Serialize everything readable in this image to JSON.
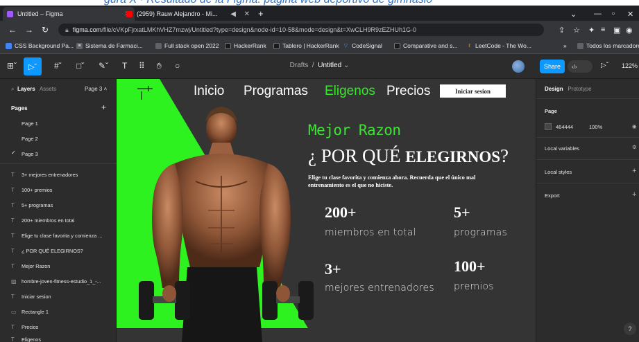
{
  "caption": "gura X · Resultado de la Figma: pagina web deportivo de gimnasio",
  "browser": {
    "tabs": [
      {
        "label": "Untitled – Figma",
        "active": true,
        "color": "#a259ff"
      },
      {
        "label": "(2959) Rauw Alejandro - Mi...",
        "active": false,
        "color": "#ff0000"
      }
    ],
    "url_host": "figma.com",
    "url_path": "/file/cVKpFjrxatLMKhVHZ7mzwj/Untitled?type=design&node-id=10-58&mode=design&t=XwCLH9R9zEZHUh1G-0",
    "bookmarks": [
      "CSS Background Pa...",
      "Sistema de Farmaci...",
      "Full stack open 2022",
      "HackerRank",
      "Tablero | HackerRank",
      "CodeSignal",
      "Comparative and s...",
      "LeetCode - The Wo..."
    ],
    "bookmarks_more": "»",
    "all_bookmarks": "Todos los marcadores"
  },
  "figma": {
    "breadcrumb_drafts": "Drafts",
    "breadcrumb_sep": "/",
    "doc_name": "Untitled",
    "share": "Share",
    "zoom": "122%",
    "left": {
      "tab_layers": "Layers",
      "tab_assets": "Assets",
      "page_selector": "Page 3",
      "pages_title": "Pages",
      "pages": [
        "Page 1",
        "Page 2",
        "Page 3"
      ],
      "layers": [
        {
          "type": "T",
          "label": "3+ mejores entrenadores"
        },
        {
          "type": "T",
          "label": "100+ premios"
        },
        {
          "type": "T",
          "label": "5+ programas"
        },
        {
          "type": "T",
          "label": "200+ miembros en total"
        },
        {
          "type": "T",
          "label": "Elige tu clase favorita y comienza ..."
        },
        {
          "type": "T",
          "label": "¿ POR QUÉ ELEGIRNOS?"
        },
        {
          "type": "T",
          "label": "Mejor Razon"
        },
        {
          "type": "img",
          "label": "hombre-joven-fitness-estudio_1_-..."
        },
        {
          "type": "T",
          "label": "Iniciar sesion"
        },
        {
          "type": "rect",
          "label": "Rectangle 1"
        },
        {
          "type": "T",
          "label": "Precios"
        },
        {
          "type": "T",
          "label": "Eligenos"
        }
      ]
    },
    "right": {
      "tab_design": "Design",
      "tab_prototype": "Prototype",
      "page_title": "Page",
      "page_color": "464444",
      "page_opacity": "100%",
      "local_variables": "Local variables",
      "local_styles": "Local styles",
      "export": "Export",
      "help": "?"
    }
  },
  "site": {
    "nav": [
      "Inicio",
      "Programas",
      "Eligenos",
      "Precios"
    ],
    "login": "Iniciar sesion",
    "kicker": "Mejor Razon",
    "headline_q": "¿",
    "headline_thin": "POR QUÉ",
    "headline_bold": "ELEGIRNOS",
    "headline_end": "?",
    "subtext": "Elige tu clase favorita y comienza ahora. Recuerda que el único mal entrenamiento es el que no hiciste.",
    "stats": [
      {
        "num": "200+",
        "label": "miembros en total"
      },
      {
        "num": "5+",
        "label": "programas"
      },
      {
        "num": "3+",
        "label": "mejores entrenadores"
      },
      {
        "num": "100+",
        "label": "premios"
      }
    ],
    "accent": "#39e62e"
  }
}
